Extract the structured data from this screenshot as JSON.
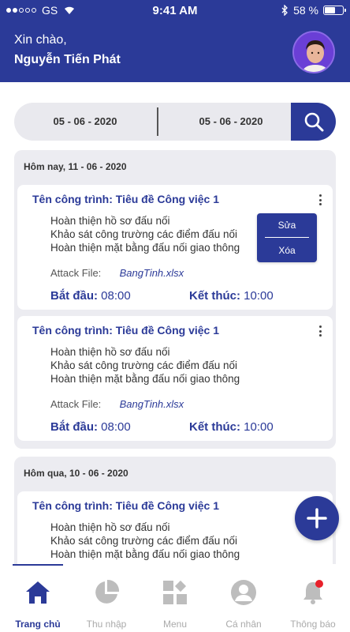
{
  "status_bar": {
    "carrier": "GS",
    "time": "9:41 AM",
    "battery": "58 %",
    "battery_level": 0.58
  },
  "header": {
    "greeting": "Xin chào,",
    "user_name": "Nguyễn Tiến Phát"
  },
  "filter": {
    "date_from": "05 - 06 - 2020",
    "date_to": "05 - 06 - 2020"
  },
  "groups": [
    {
      "title": "Hôm nay, 11 - 06 - 2020",
      "cards": [
        {
          "title": "Tên công trình: Tiêu đề Công việc 1",
          "tasks": [
            "Hoàn thiện hồ sơ đấu nối",
            "Khảo sát công trường các điểm đấu nối",
            "Hoàn thiện mặt bằng đấu nối giao thông"
          ],
          "file_label": "Attack File:",
          "file_name": "BangTinh.xlsx",
          "start_label": "Bắt đầu:",
          "start_time": "08:00",
          "end_label": "Kết thúc:",
          "end_time": "10:00"
        },
        {
          "title": "Tên công trình: Tiêu đề Công việc 1",
          "tasks": [
            "Hoàn thiện hồ sơ đấu nối",
            "Khảo sát công trường các điểm đấu nối",
            "Hoàn thiện mặt bằng đấu nối giao thông"
          ],
          "file_label": "Attack File:",
          "file_name": "BangTinh.xlsx",
          "start_label": "Bắt đầu:",
          "start_time": "08:00",
          "end_label": "Kết thúc:",
          "end_time": "10:00"
        }
      ]
    },
    {
      "title": "Hôm qua, 10 - 06 - 2020",
      "cards": [
        {
          "title": "Tên công trình: Tiêu đề Công việc 1",
          "tasks": [
            "Hoàn thiện hồ sơ đấu nối",
            "Khảo sát công trường các điểm đấu nối",
            "Hoàn thiện mặt bằng đấu nối giao thông"
          ]
        }
      ]
    }
  ],
  "context_menu": {
    "edit": "Sửa",
    "delete": "Xóa"
  },
  "tabs": [
    {
      "label": "Trang chủ",
      "icon": "home-icon",
      "active": true
    },
    {
      "label": "Thu nhập",
      "icon": "pie-chart-icon"
    },
    {
      "label": "Menu",
      "icon": "grid-icon"
    },
    {
      "label": "Cá nhân",
      "icon": "person-icon"
    },
    {
      "label": "Thông báo",
      "icon": "bell-icon",
      "badge": true
    }
  ],
  "colors": {
    "primary": "#2b3a98",
    "background_group": "#ececf1",
    "badge": "#e8202a"
  }
}
